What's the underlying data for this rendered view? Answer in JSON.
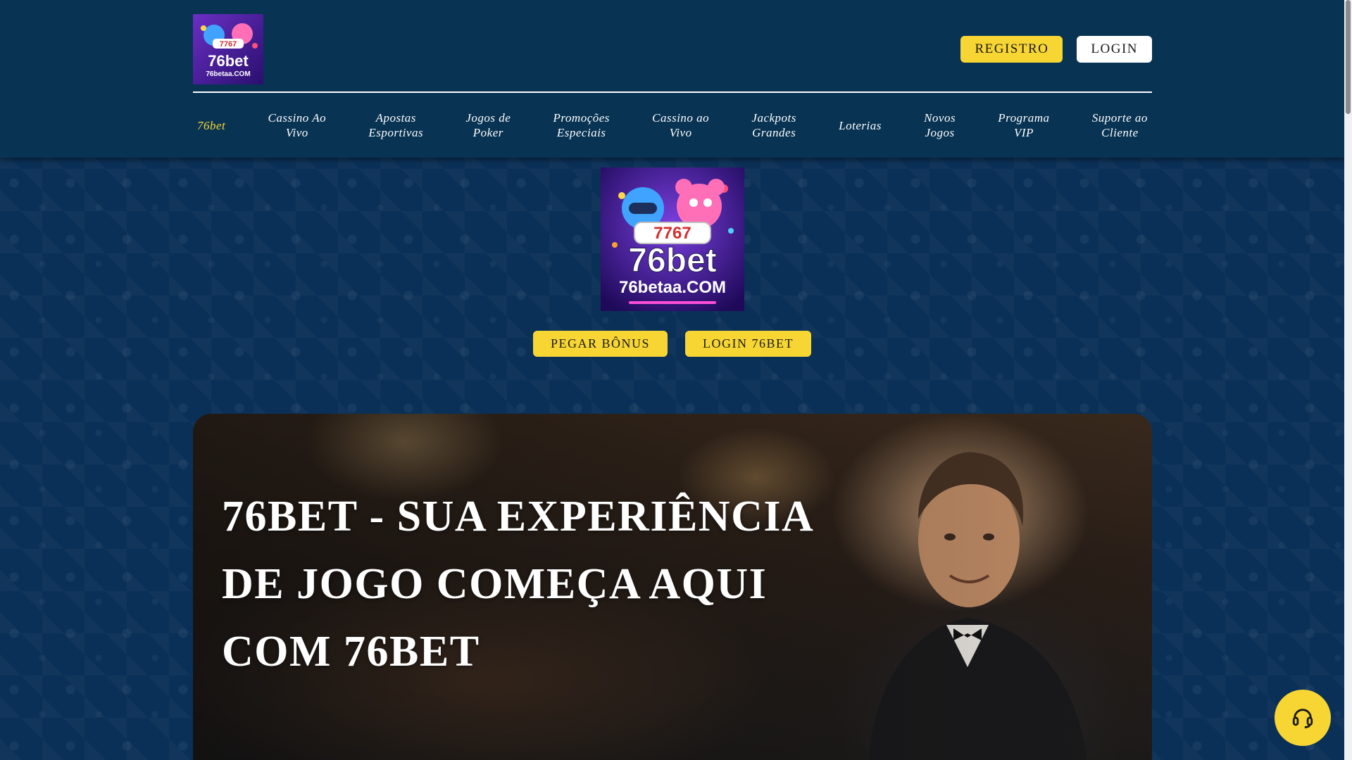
{
  "header": {
    "logo_alt": "76bet 76betaa.COM",
    "registro_label": "REGISTRO",
    "login_label": "LOGIN"
  },
  "nav": {
    "items": [
      {
        "label": "76bet"
      },
      {
        "label": "Cassino Ao\nVivo"
      },
      {
        "label": "Apostas\nEsportivas"
      },
      {
        "label": "Jogos de\nPoker"
      },
      {
        "label": "Promoções\nEspeciais"
      },
      {
        "label": "Cassino ao\nVivo"
      },
      {
        "label": "Jackpots\nGrandes"
      },
      {
        "label": "Loterias"
      },
      {
        "label": "Novos\nJogos"
      },
      {
        "label": "Programa\nVIP"
      },
      {
        "label": "Suporte ao\nCliente"
      }
    ]
  },
  "hero": {
    "logo_text_brand": "76bet",
    "logo_text_domain": "76betaa.COM",
    "logo_reels": "7767",
    "bonus_label": "PEGAR BÔNUS",
    "login_label": "LOGIN 76BET"
  },
  "banner": {
    "title": "76BET - SUA EXPERIÊNCIA DE JOGO COMEÇA AQUI COM 76BET"
  },
  "colors": {
    "header_bg": "#083353",
    "page_bg": "#0b3057",
    "accent_yellow": "#f7d634",
    "nav_active": "#f7d634"
  },
  "icons": {
    "support": "headset-icon"
  }
}
